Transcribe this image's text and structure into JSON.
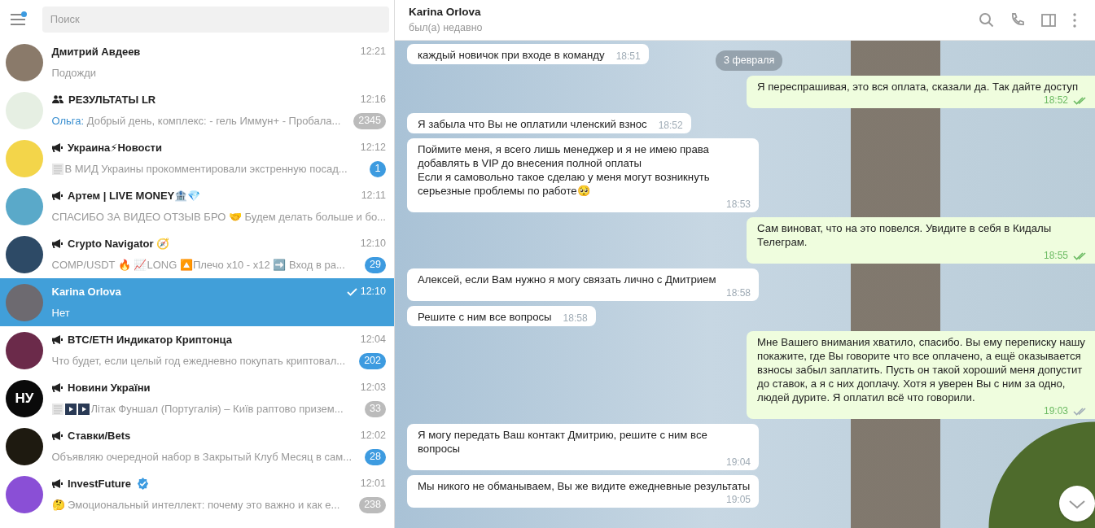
{
  "sidebar": {
    "menu_notification": true,
    "search": {
      "placeholder": "Поиск"
    },
    "chats": [
      {
        "name": "Дмитрий Авдеев",
        "kind": "user",
        "time": "12:21",
        "preview": "Подожди",
        "color": "#8a7a6a",
        "selected": false
      },
      {
        "name": "РЕЗУЛЬТАТЫ LR",
        "kind": "group",
        "time": "12:16",
        "sender": "Ольга:",
        "preview": "Добрый день, комплекс:  - гель Иммун+ - Пробала...",
        "badge": "2345",
        "muted": true,
        "color": "#e6efe3",
        "selected": false
      },
      {
        "name": "Украина⚡Новости",
        "kind": "channel",
        "time": "12:12",
        "thumbs": [
          {
            "kind": "doc"
          }
        ],
        "preview": "В МИД Украины прокомментировали экстренную посад...",
        "badge": "1",
        "muted": false,
        "color": "#f3d54a",
        "selected": false
      },
      {
        "name": "Артем | LIVE MONEY🏦💎",
        "kind": "channel",
        "time": "12:11",
        "preview": "СПАСИБО ЗА ВИДЕО ОТЗЫВ БРО 🤝  Будем делать больше и бо...",
        "color": "#5aa9c9",
        "selected": false
      },
      {
        "name": "Crypto Navigator 🧭",
        "kind": "channel",
        "time": "12:10",
        "preview": "COMP/USDT 🔥  📈LONG 🔼Плечо x10 - x12  ➡️ Вход в ра...",
        "badge": "29",
        "muted": false,
        "color": "#2d4a66",
        "selected": false
      },
      {
        "name": "Karina Orlova",
        "kind": "user",
        "time": "12:10",
        "sent": true,
        "preview": "Нет",
        "color": "#6d6a70",
        "selected": true
      },
      {
        "name": "BTC/ETH Индикатор Криптонца",
        "kind": "channel",
        "time": "12:04",
        "preview": "Что будет, если целый год ежедневно покупать криптовал...",
        "badge": "202",
        "muted": false,
        "color": "#6b2a4a",
        "selected": false
      },
      {
        "name": "Новини України",
        "kind": "channel",
        "time": "12:03",
        "avatar_text": "НУ",
        "thumbs": [
          {
            "kind": "doc"
          },
          {
            "kind": "video"
          },
          {
            "kind": "video"
          }
        ],
        "preview": "Літак Фуншал (Португалія) – Київ раптово призем...",
        "badge": "33",
        "muted": true,
        "color": "#0a0a0a",
        "selected": false
      },
      {
        "name": "Ставки/Bets",
        "kind": "channel",
        "time": "12:02",
        "preview": "Объявляю очередной набор в Закрытый Клуб  Месяц в сам...",
        "badge": "28",
        "muted": false,
        "color": "#1e1a10",
        "selected": false
      },
      {
        "name": "InvestFuture",
        "kind": "channel",
        "verified": true,
        "time": "12:01",
        "preview": "🤔 Эмоциональный интеллект: почему это важно и как е...",
        "badge": "238",
        "muted": true,
        "color": "#8a4fd6",
        "selected": false
      }
    ]
  },
  "chat": {
    "title": "Karina Orlova",
    "status": "был(а) недавно",
    "date": "3 февраля",
    "messages": [
      {
        "kind": "in",
        "text": "каждый новичок при входе в команду",
        "time": "18:51"
      },
      {
        "kind": "out",
        "text": "Я переспрашивая, это вся оплата, сказали да. Так дайте доступ",
        "time": "18:52",
        "read": true
      },
      {
        "kind": "in",
        "text": "Я забыла что Вы не оплатили членский взнос",
        "time": "18:52"
      },
      {
        "kind": "in",
        "text": "Поймите меня, я всего лишь менеджер и я не имею права добавлять в VIP до внесения полной оплаты\nЕсли я самовольно такое сделаю у меня могут возникнуть серьезные проблемы по работе🥺",
        "time": "18:53"
      },
      {
        "kind": "out",
        "text": "Сам виноват, что на это повелся. Увидите в себя в Кидалы Телеграм.",
        "time": "18:55",
        "read": true
      },
      {
        "kind": "in",
        "text": "Алексей, если Вам нужно я могу связать лично с Дмитрием",
        "time": "18:58"
      },
      {
        "kind": "in",
        "text": "Решите с ним все вопросы",
        "time": "18:58"
      },
      {
        "kind": "out",
        "text": "Мне Вашего внимания хватило, спасибо. Вы ему переписку нашу покажите, где Вы говорите что все оплачено, а ещё оказывается взносы забыл заплатить. Пусть он такой хороший меня допустит до ставок, а я с них доплачу. Хотя я уверен Вы с ним за одно, людей дурите. Я оплатил всё что говорили.",
        "time": "19:03",
        "read": false
      },
      {
        "kind": "in",
        "text": "Я могу передать Ваш контакт Дмитрию, решите с ним все вопросы",
        "time": "19:04"
      },
      {
        "kind": "in",
        "text": "Мы никого не обманываем, Вы же видите ежедневные результаты",
        "time": "19:05"
      }
    ]
  }
}
